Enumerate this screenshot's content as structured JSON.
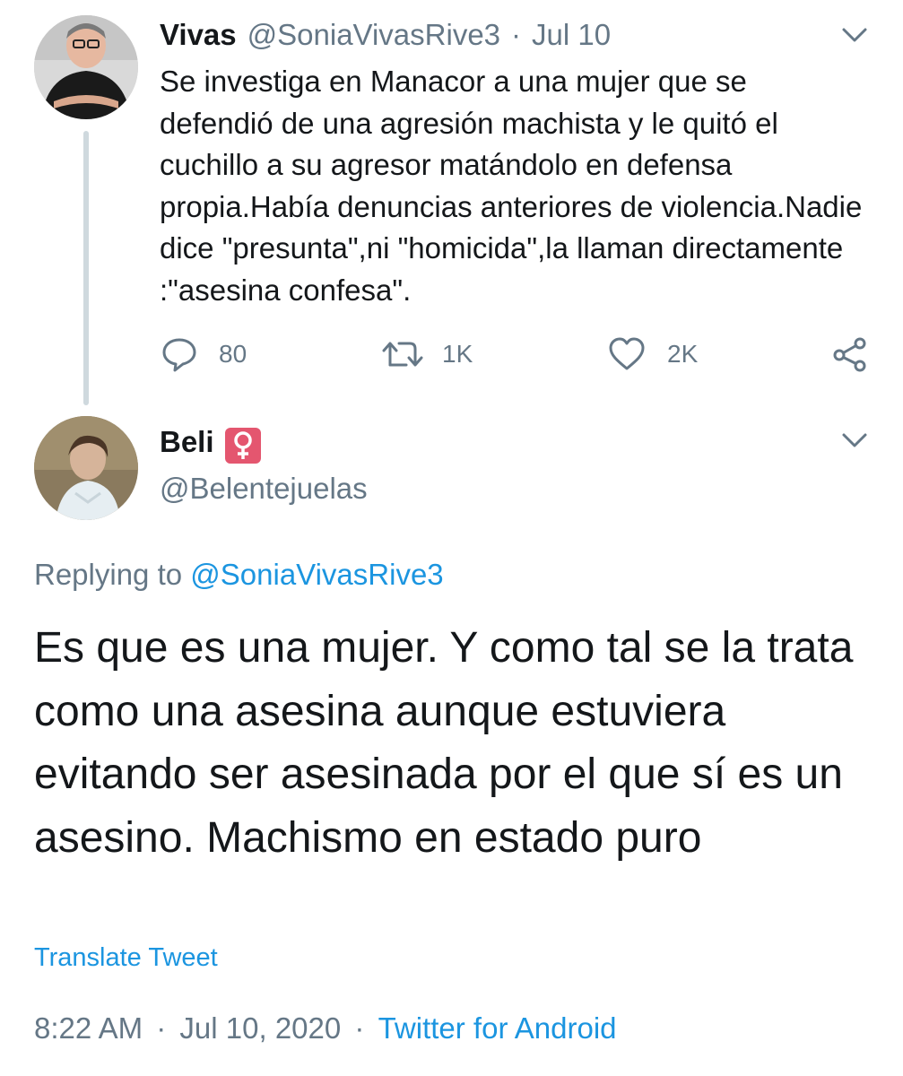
{
  "original_tweet": {
    "author_name": "Vivas",
    "handle": "@SoniaVivasRive3",
    "separator": "·",
    "date": "Jul 10",
    "text": "Se investiga en Manacor a una mujer que se defendió de una agresión machista y le quitó el cuchillo a su agresor matándolo en defensa propia.Había denuncias anteriores de violencia.Nadie dice \"presunta\",ni \"homicida\",la llaman directamente :\"asesina confesa\".",
    "actions": {
      "reply_count": "80",
      "retweet_count": "1K",
      "like_count": "2K"
    },
    "icons": [
      "reply-icon",
      "retweet-icon",
      "like-icon",
      "share-icon",
      "chevron-down-icon"
    ]
  },
  "reply_tweet": {
    "author_name": "Beli",
    "name_emoji": "♀",
    "handle": "@Belentejuelas",
    "replying_prefix": "Replying to",
    "replying_handle": "@SoniaVivasRive3",
    "text": "Es que es una mujer. Y como tal se la trata como una asesina aunque estuviera evitando ser asesinada por el que sí es un asesino. Machismo en estado puro",
    "translate_label": "Translate Tweet",
    "time": "8:22 AM",
    "separator": "·",
    "date": "Jul 10, 2020",
    "source": "Twitter for Android"
  },
  "colors": {
    "text": "#14171a",
    "muted": "#657786",
    "link": "#1b95e0",
    "thread_line": "#cfd9de",
    "emoji_bg": "#e4566f"
  }
}
